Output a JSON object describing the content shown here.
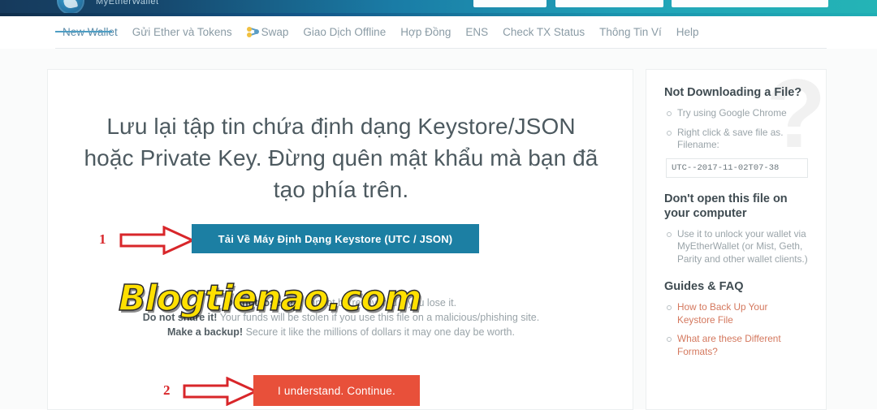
{
  "topbar": {
    "logo_icon": "mew-logo-icon",
    "brand": "MyEtherWallet",
    "selectors": [
      "",
      "",
      ""
    ]
  },
  "nav": {
    "items": [
      {
        "label": "New Wallet",
        "active": true,
        "icon": ""
      },
      {
        "label": "Gửi Ether và Tokens",
        "active": false,
        "icon": ""
      },
      {
        "label": "Swap",
        "active": false,
        "icon": "swap-icon"
      },
      {
        "label": "Giao Dịch Offline",
        "active": false,
        "icon": ""
      },
      {
        "label": "Hợp Đồng",
        "active": false,
        "icon": ""
      },
      {
        "label": "ENS",
        "active": false,
        "icon": ""
      },
      {
        "label": "Check TX Status",
        "active": false,
        "icon": ""
      },
      {
        "label": "Thông Tin Ví",
        "active": false,
        "icon": ""
      },
      {
        "label": "Help",
        "active": false,
        "icon": ""
      }
    ]
  },
  "main": {
    "headline": "Lưu lại tập tin chứa định dạng Keystore/JSON hoặc Private Key. Đừng quên mật khẩu mà bạn đã tạo phía trên.",
    "step1_number": "1",
    "step2_number": "2",
    "download_button": "Tải Về Máy Định Dạng Keystore (UTC / JSON)",
    "continue_button": "I understand. Continue.",
    "warnings": [
      {
        "bold": "Do not lose it!",
        "rest": " It cannot be recovered if you lose it."
      },
      {
        "bold": "Do not share it!",
        "rest": " Your funds will be stolen if you use this file on a malicious/phishing site."
      },
      {
        "bold": "Make a backup!",
        "rest": " Secure it like the millions of dollars it may one day be worth."
      }
    ]
  },
  "sidebar": {
    "section1_title": "Not Downloading a File?",
    "section1_items": [
      "Try using Google Chrome",
      "Right click & save file as. Filename:"
    ],
    "filename": "UTC--2017-11-02T07-38",
    "section2_title": "Don't open this file on your computer",
    "section2_items": [
      "Use it to unlock your wallet via MyEtherWallet (or Mist, Geth, Parity and other wallet clients.)"
    ],
    "section3_title": "Guides & FAQ",
    "section3_items": [
      "How to Back Up Your Keystore File",
      "What are these Different Formats?"
    ],
    "watermark_glyph": "?"
  },
  "watermark": {
    "text": "Blogtienao.com"
  },
  "colors": {
    "download_blue": "#1c7fa3",
    "continue_red": "#e8503a",
    "arrow_red": "#d8262a",
    "faq_link": "#d4785e",
    "watermark_yellow": "#ffe000"
  }
}
